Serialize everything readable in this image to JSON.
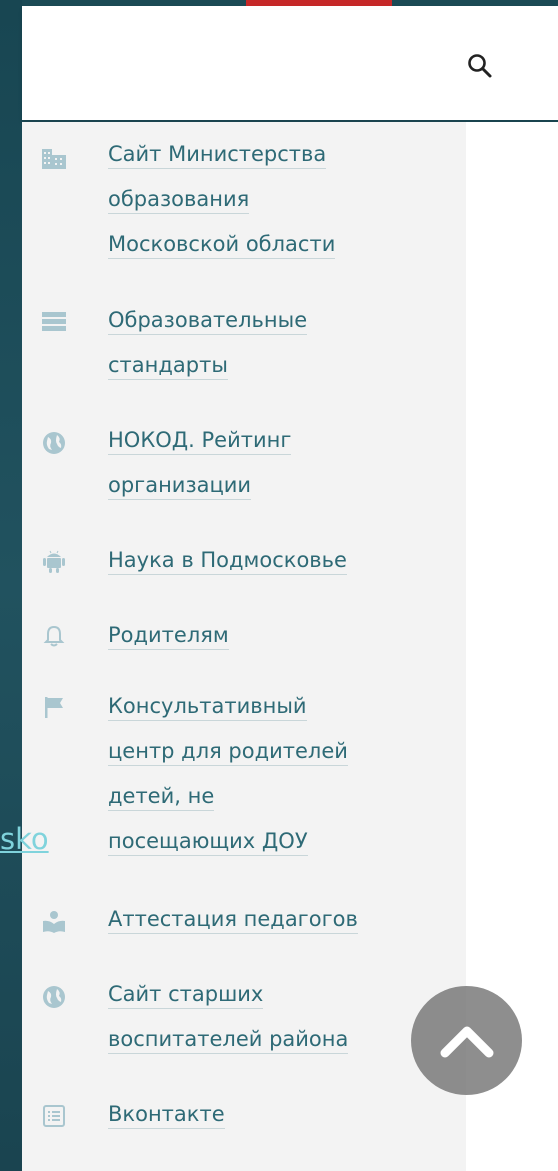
{
  "header": {
    "search_icon": "search-icon"
  },
  "side_link": {
    "text": "sko"
  },
  "menu": {
    "items": [
      {
        "icon": "building-icon",
        "lines": [
          "Сайт Министерства",
          "образования",
          "Московской области"
        ]
      },
      {
        "icon": "server-list-icon",
        "lines": [
          "Образовательные",
          "стандарты"
        ]
      },
      {
        "icon": "globe-icon",
        "lines": [
          "НОКОД. Рейтинг",
          "организации"
        ]
      },
      {
        "icon": "android-icon",
        "lines": [
          "Наука в Подмосковье"
        ]
      },
      {
        "icon": "bell-icon",
        "lines": [
          "Родителям"
        ]
      },
      {
        "icon": "flag-icon",
        "lines": [
          "Консультативный",
          "центр для родителей",
          "детей, не",
          "посещающих ДОУ"
        ]
      },
      {
        "icon": "teacher-reading-icon",
        "lines": [
          "Аттестация педагогов"
        ]
      },
      {
        "icon": "globe-icon",
        "lines": [
          "Сайт старших",
          "воспитателей района"
        ]
      },
      {
        "icon": "list-icon",
        "lines": [
          "Вконтакте"
        ]
      }
    ]
  },
  "scroll_top": {
    "icon": "chevron-up-icon"
  },
  "colors": {
    "link": "#2e6a76",
    "icon": "#a9c6cf",
    "panel": "#f3f3f3",
    "accent_red": "#c62828",
    "side_link": "#7fd3dc"
  }
}
